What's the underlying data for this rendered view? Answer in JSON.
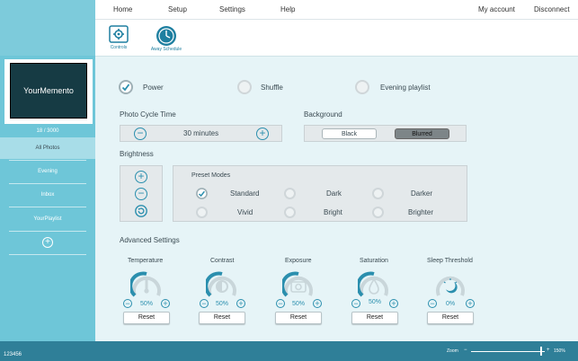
{
  "menu": {
    "home": "Home",
    "setup": "Setup",
    "settings": "Settings",
    "help": "Help",
    "my_account": "My account",
    "disconnect": "Disconnect"
  },
  "toolbar": {
    "controls": "Controls",
    "away_schedule": "Away Schedule"
  },
  "sidebar": {
    "frame_title": "YourMemento",
    "photo_count": "18 / 3000",
    "items": [
      {
        "label": "All Photos",
        "selected": true
      },
      {
        "label": "Evening"
      },
      {
        "label": "Inbox"
      },
      {
        "label": "YourPlaylist"
      }
    ]
  },
  "toggles": {
    "power": "Power",
    "shuffle": "Shuffle",
    "evening_playlist": "Evening playlist",
    "power_on": true
  },
  "photo_cycle": {
    "title": "Photo Cycle Time",
    "value": "30 minutes"
  },
  "background": {
    "title": "Background",
    "black": "Black",
    "blurred": "Blurred",
    "selected": "Blurred"
  },
  "brightness": {
    "title": "Brightness",
    "preset_title": "Preset Modes",
    "modes": [
      "Standard",
      "Dark",
      "Darker",
      "Vivid",
      "Bright",
      "Brighter"
    ],
    "selected": "Standard"
  },
  "advanced": {
    "title": "Advanced Settings",
    "reset_label": "Reset",
    "controls": [
      {
        "name": "Temperature",
        "value": "50%",
        "icon": "thermometer-icon"
      },
      {
        "name": "Contrast",
        "value": "50%",
        "icon": "contrast-icon"
      },
      {
        "name": "Exposure",
        "value": "50%",
        "icon": "camera-icon"
      },
      {
        "name": "Saturation",
        "value": "50%",
        "icon": "drop-icon"
      },
      {
        "name": "Sleep Threshold",
        "value": "0%",
        "icon": "sleep-icon"
      }
    ]
  },
  "statusbar": {
    "device_id": "123456",
    "zoom_label": "Zoom",
    "zoom_value": "150%",
    "zoom_minus": "−",
    "zoom_plus": "+"
  },
  "colors": {
    "accent": "#2b8fae",
    "sidebar": "#6ec6d8",
    "bottom": "#2f7f98"
  }
}
